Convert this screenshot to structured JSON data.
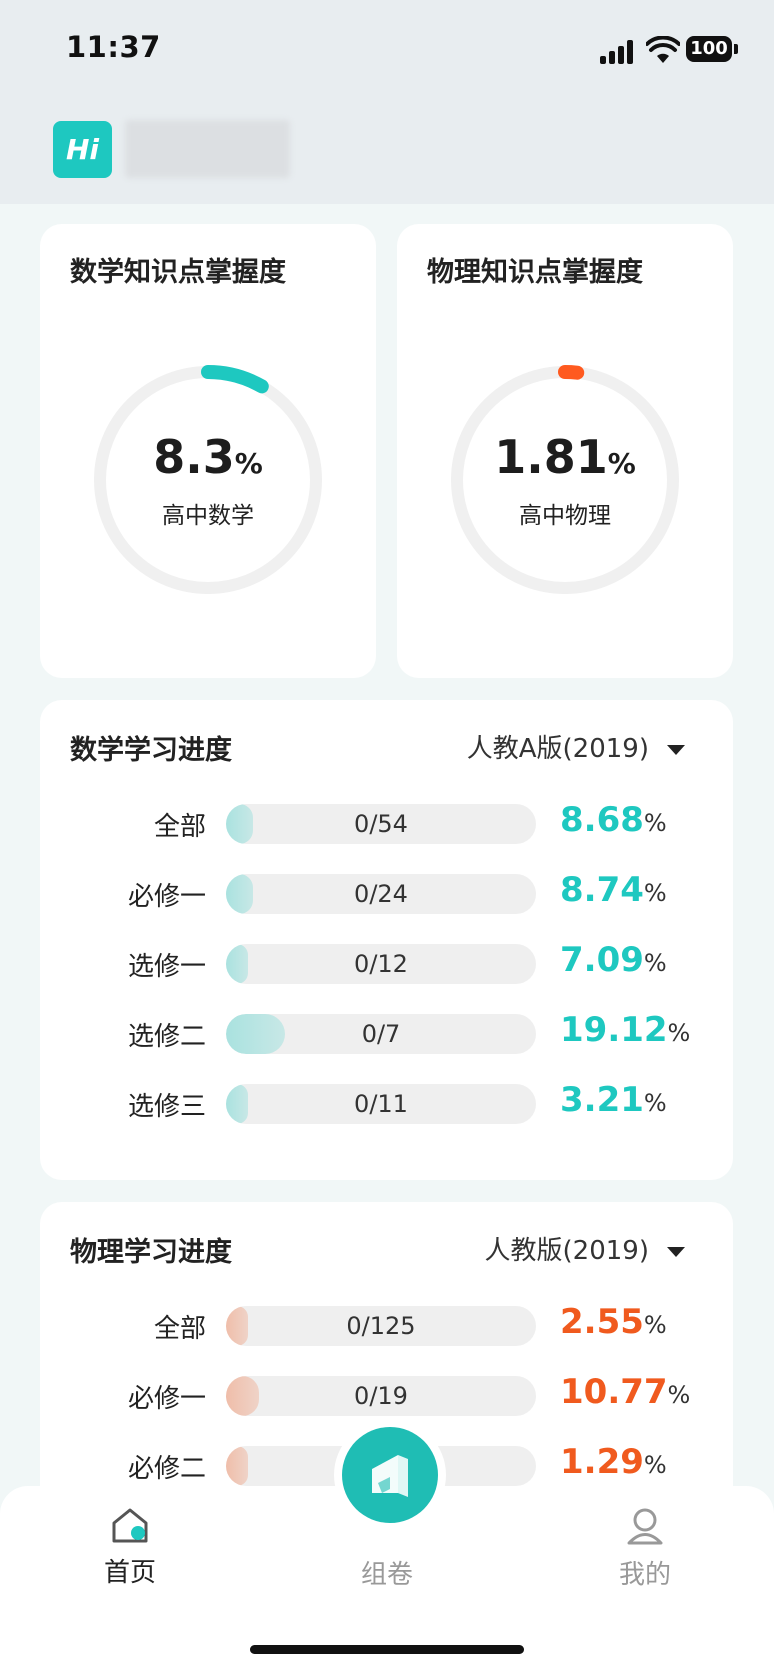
{
  "status": {
    "time": "11:37",
    "battery": "100"
  },
  "header": {
    "badge": "Hi"
  },
  "mastery": [
    {
      "title": "数学知识点掌握度",
      "value": "8.3",
      "unit": "%",
      "subject": "高中数学",
      "progress": 0.083,
      "color": "#1ec8c0"
    },
    {
      "title": "物理知识点掌握度",
      "value": "1.81",
      "unit": "%",
      "subject": "高中物理",
      "progress": 0.0181,
      "color": "#ff5a1f"
    }
  ],
  "math_progress": {
    "title": "数学学习进度",
    "edition": "人教A版(2019)",
    "accent": "#1ec8c0",
    "rows": [
      {
        "label": "全部",
        "count": "0/54",
        "pct": "8.68",
        "unit": "%",
        "fill": 0.0868
      },
      {
        "label": "必修一",
        "count": "0/24",
        "pct": "8.74",
        "unit": "%",
        "fill": 0.0874
      },
      {
        "label": "选修一",
        "count": "0/12",
        "pct": "7.09",
        "unit": "%",
        "fill": 0.0709
      },
      {
        "label": "选修二",
        "count": "0/7",
        "pct": "19.12",
        "unit": "%",
        "fill": 0.1912
      },
      {
        "label": "选修三",
        "count": "0/11",
        "pct": "3.21",
        "unit": "%",
        "fill": 0.0321
      }
    ]
  },
  "physics_progress": {
    "title": "物理学习进度",
    "edition": "人教版(2019)",
    "accent": "#f05a1e",
    "rows": [
      {
        "label": "全部",
        "count": "0/125",
        "pct": "2.55",
        "unit": "%",
        "fill": 0.0255
      },
      {
        "label": "必修一",
        "count": "0/19",
        "pct": "10.77",
        "unit": "%",
        "fill": 0.1077
      },
      {
        "label": "必修二",
        "count": "",
        "pct": "1.29",
        "unit": "%",
        "fill": 0.0129
      }
    ]
  },
  "tabs": [
    {
      "label": "首页",
      "icon": "home-icon",
      "active": true
    },
    {
      "label": "组卷",
      "icon": "compose-icon",
      "active": false
    },
    {
      "label": "我的",
      "icon": "profile-icon",
      "active": false
    }
  ]
}
